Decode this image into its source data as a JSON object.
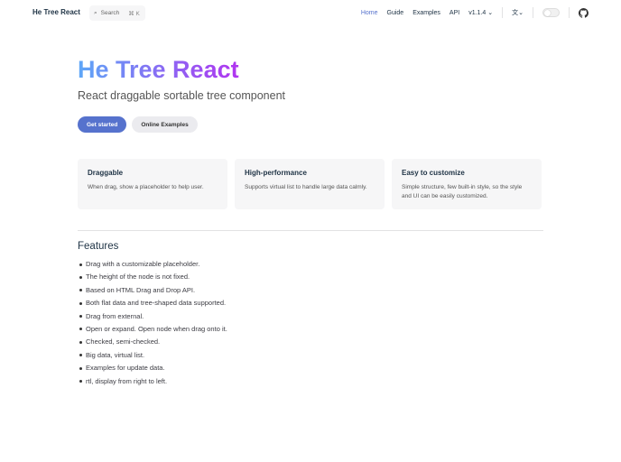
{
  "nav": {
    "brand": "He Tree React",
    "search": "Search",
    "shortcut": "⌘ K",
    "links": [
      "Home",
      "Guide",
      "Examples",
      "API"
    ],
    "version": "v1.1.4"
  },
  "hero": {
    "title": "He Tree React",
    "tagline": "React draggable sortable tree component",
    "primary": "Get started",
    "secondary": "Online Examples"
  },
  "cards": [
    {
      "title": "Draggable",
      "text": "When drag, show a placeholder to help user."
    },
    {
      "title": "High-performance",
      "text": "Supports virtual list to handle large data calmly."
    },
    {
      "title": "Easy to customize",
      "text": "Simple structure, few built-in style, so the style and UI can be easily customized."
    }
  ],
  "features": {
    "title": "Features",
    "items": [
      "Drag with a customizable placeholder.",
      "The height of the node is not fixed.",
      "Based on HTML Drag and Drop API.",
      "Both flat data and tree-shaped data supported.",
      "Drag from external.",
      "Open or expand. Open node when drag onto it.",
      "Checked, semi-checked.",
      "Big data, virtual list.",
      "Examples for update data.",
      "rtl, display from right to left."
    ]
  }
}
